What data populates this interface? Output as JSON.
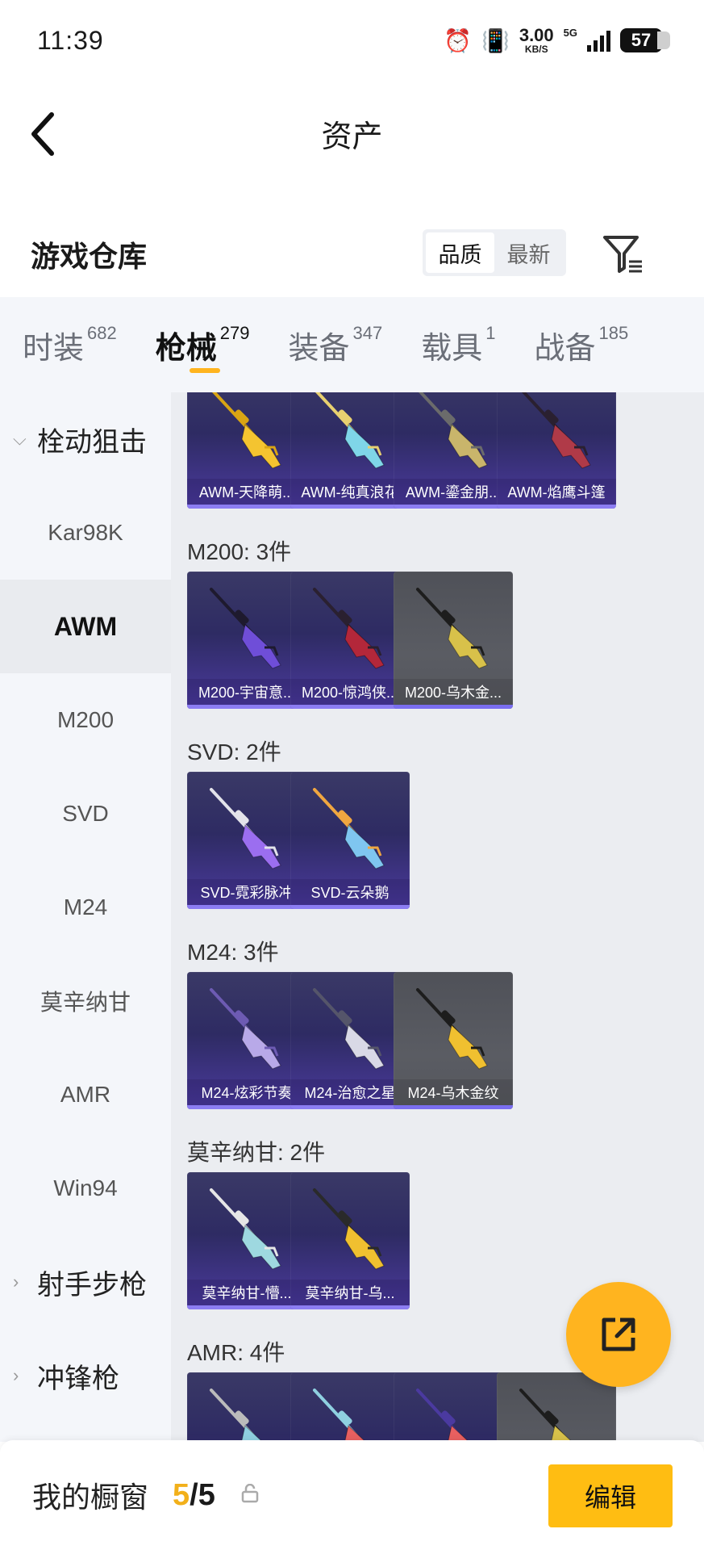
{
  "status_bar": {
    "time": "11:39",
    "net_speed": "3.00",
    "net_unit": "KB/S",
    "network": "5G",
    "battery": "57"
  },
  "header": {
    "title": "资产"
  },
  "warehouse": {
    "title": "游戏仓库",
    "sort_options": [
      "品质",
      "最新"
    ],
    "active_sort": "品质"
  },
  "tabs": [
    {
      "label": "时装",
      "count": "682"
    },
    {
      "label": "枪械",
      "count": "279",
      "active": true
    },
    {
      "label": "装备",
      "count": "347"
    },
    {
      "label": "载具",
      "count": "1"
    },
    {
      "label": "战备",
      "count": "185"
    }
  ],
  "sidebar": [
    {
      "label": "栓动狙击",
      "type": "group",
      "expanded": true
    },
    {
      "label": "Kar98K"
    },
    {
      "label": "AWM",
      "active": true
    },
    {
      "label": "M200"
    },
    {
      "label": "SVD"
    },
    {
      "label": "M24"
    },
    {
      "label": "莫辛纳甘"
    },
    {
      "label": "AMR"
    },
    {
      "label": "Win94"
    },
    {
      "label": "射手步枪",
      "type": "group"
    },
    {
      "label": "冲锋枪",
      "type": "group"
    }
  ],
  "sections": [
    {
      "title": "",
      "items": [
        "AWM-天降萌...",
        "AWM-纯真浪花",
        "AWM-鎏金朋...",
        "AWM-焰鹰斗篷"
      ]
    },
    {
      "title": "M200: 3件",
      "items": [
        "M200-宇宙意...",
        "M200-惊鸿侠...",
        "M200-乌木金..."
      ]
    },
    {
      "title": "SVD: 2件",
      "items": [
        "SVD-霓彩脉冲",
        "SVD-云朵鹅"
      ]
    },
    {
      "title": "M24: 3件",
      "items": [
        "M24-炫彩节奏",
        "M24-治愈之星",
        "M24-乌木金纹"
      ]
    },
    {
      "title": "莫辛纳甘: 2件",
      "items": [
        "莫辛纳甘-懵...",
        "莫辛纳甘-乌..."
      ]
    },
    {
      "title": "AMR: 4件",
      "items": [
        "",
        "",
        "",
        ""
      ]
    }
  ],
  "bottom": {
    "showcase_label": "我的橱窗",
    "current": "5",
    "separator": "/",
    "total": "5",
    "edit_label": "编辑"
  },
  "colors": {
    "accent": "#ffb41f",
    "card_purple": "#3a3966",
    "card_gray": "#55575d"
  }
}
